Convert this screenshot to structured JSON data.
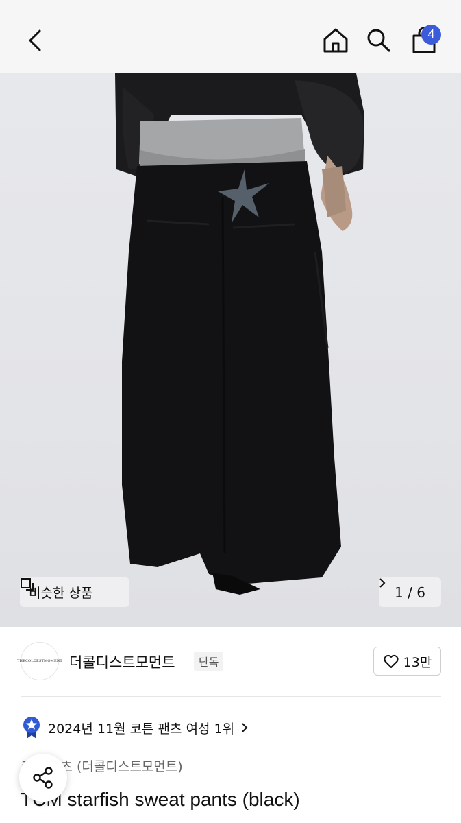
{
  "header": {
    "cart_count": "4",
    "icons": [
      "chevron-left-icon",
      "home-icon",
      "search-icon",
      "shopping-bag-icon"
    ]
  },
  "hero": {
    "similar_label": "비슷한 상품",
    "pager": "1 / 6"
  },
  "brand": {
    "logo_text": "THECOLDESTMOMENT",
    "name": "더콜디스트모먼트",
    "exclusive_tag": "단독",
    "likes": "13만"
  },
  "ranking": {
    "text": "2024년 11월 코튼 팬츠 여성 1위"
  },
  "product": {
    "category": "코튼 팬츠 (더콜디스트모먼트)",
    "title": "TCM starfish sweat pants (black)"
  },
  "colors": {
    "badge": "#3b5bdb",
    "header_bg": "#f6f6f7",
    "ranking_medal": "#2f5bd8"
  }
}
